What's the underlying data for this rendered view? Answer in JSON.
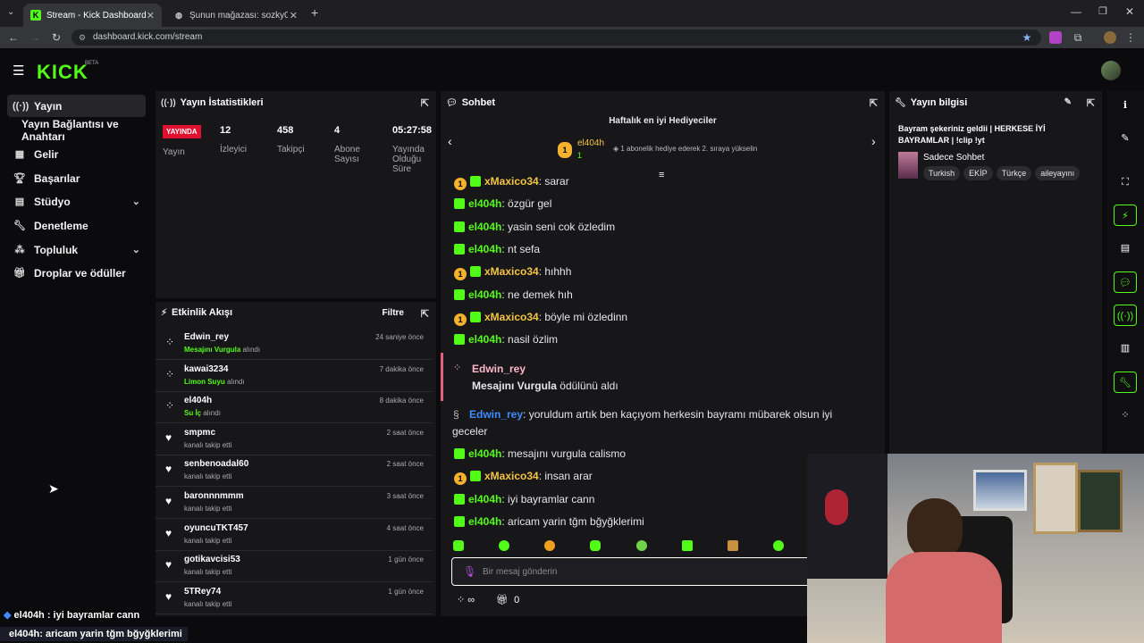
{
  "browser": {
    "tabs": [
      {
        "title": "Stream - Kick Dashboard",
        "active": true
      },
      {
        "title": "Şunun mağazası: sozky0 | Yayın",
        "active": false
      }
    ],
    "url": "dashboard.kick.com/stream"
  },
  "sidebar": {
    "items": [
      {
        "label": "Yayın",
        "icon": "broadcast-icon",
        "active": true
      },
      {
        "label": "Yayın Bağlantısı ve Anahtarı",
        "icon": "",
        "active": false
      },
      {
        "label": "Gelir",
        "icon": "revenue-icon",
        "active": false
      },
      {
        "label": "Başarılar",
        "icon": "trophy-icon",
        "active": false
      },
      {
        "label": "Stüdyo",
        "icon": "studio-icon",
        "active": false,
        "expandable": true
      },
      {
        "label": "Denetleme",
        "icon": "wrench-icon",
        "active": false
      },
      {
        "label": "Topluluk",
        "icon": "community-icon",
        "active": false,
        "expandable": true
      },
      {
        "label": "Droplar ve ödüller",
        "icon": "gift-icon",
        "active": false
      }
    ]
  },
  "stats": {
    "title": "Yayın İstatistikleri",
    "live_badge": "YAYINDA",
    "live_label": "Yayın",
    "viewers": {
      "value": "12",
      "label": "İzleyici"
    },
    "followers": {
      "value": "458",
      "label": "Takipçi"
    },
    "subs": {
      "value": "4",
      "label": "Abone Sayısı"
    },
    "uptime": {
      "value": "05:27:58",
      "label": "Yayında Olduğu Süre"
    }
  },
  "events": {
    "title": "Etkinlik Akışı",
    "filter": "Filtre",
    "rows": [
      {
        "name": "Edwin_rey",
        "reward": "Mesajını Vurgula",
        "suffix": "alındı",
        "time": "24 saniye önce",
        "icon": "reward-icon"
      },
      {
        "name": "kawai3234",
        "reward": "Limon Suyu",
        "suffix": "alındı",
        "time": "7 dakika önce",
        "icon": "reward-icon"
      },
      {
        "name": "el404h",
        "reward": "Su İç",
        "suffix": "alındı",
        "time": "8 dakika önce",
        "icon": "reward-icon"
      },
      {
        "name": "smpmc",
        "reward": "",
        "suffix": "kanalı takip etti",
        "time": "2 saat önce",
        "icon": "heart-icon"
      },
      {
        "name": "senbenoadal60",
        "reward": "",
        "suffix": "kanalı takip etti",
        "time": "2 saat önce",
        "icon": "heart-icon"
      },
      {
        "name": "baronnnmmm",
        "reward": "",
        "suffix": "kanalı takip etti",
        "time": "3 saat önce",
        "icon": "heart-icon"
      },
      {
        "name": "oyuncuTKT457",
        "reward": "",
        "suffix": "kanalı takip etti",
        "time": "4 saat önce",
        "icon": "heart-icon"
      },
      {
        "name": "gotikavcisi53",
        "reward": "",
        "suffix": "kanalı takip etti",
        "time": "1 gün önce",
        "icon": "heart-icon"
      },
      {
        "name": "5TRey74",
        "reward": "",
        "suffix": "kanalı takip etti",
        "time": "1 gün önce",
        "icon": "heart-icon"
      }
    ]
  },
  "chat": {
    "title": "Sohbet",
    "gifters_title": "Haftalık en iyi Hediyeciler",
    "top_gifter": {
      "name": "el404h",
      "count": "1",
      "note": "1 abonelik hediye ederek 2. sıraya yükselin"
    },
    "messages": [
      {
        "user": "xMaxico34",
        "color": "yellow",
        "text": "sarar",
        "badge1": true
      },
      {
        "user": "el404h",
        "color": "green",
        "text": "özgür gel",
        "badge1": false
      },
      {
        "user": "el404h",
        "color": "green",
        "text": "yasin seni cok özledim",
        "badge1": false
      },
      {
        "user": "el404h",
        "color": "green",
        "text": "nt sefa",
        "badge1": false
      },
      {
        "user": "xMaxico34",
        "color": "yellow",
        "text": "hıhhh",
        "badge1": true
      },
      {
        "user": "el404h",
        "color": "green",
        "text": "ne demek hıh",
        "badge1": false
      },
      {
        "user": "xMaxico34",
        "color": "yellow",
        "text": "böyle mi özledinn",
        "badge1": true
      },
      {
        "user": "el404h",
        "color": "green",
        "text": "nasil özlim",
        "badge1": false
      }
    ],
    "reward_event": {
      "user": "Edwin_rey",
      "reward": "Mesajını Vurgula",
      "suffix": "ödülünü aldı"
    },
    "highlight": {
      "user": "Edwin_rey",
      "text": "yoruldum artık ben kaçıyom herkesin bayramı mübarek olsun iyi",
      "text2": "geceler"
    },
    "messages2": [
      {
        "user": "el404h",
        "color": "green",
        "text": "mesajını vurgula calismo",
        "badge1": false
      },
      {
        "user": "xMaxico34",
        "color": "yellow",
        "text": "insan arar",
        "badge1": true
      },
      {
        "user": "el404h",
        "color": "green",
        "text": "iyi bayramlar cann",
        "badge1": false
      },
      {
        "user": "el404h",
        "color": "green",
        "text": "aricam yarin tğm bğyğklerimi",
        "badge1": false
      }
    ],
    "input_placeholder": "Bir mesaj gönderin",
    "footer_count": "0",
    "infinity": "∞"
  },
  "info": {
    "title": "Yayın bilgisi",
    "stream_title": "Bayram şekeriniz geldii | HERKESE İYİ BAYRAMLAR | !clip !yt",
    "category": "Sadece Sohbet",
    "tags": [
      "Turkish",
      "EKİP",
      "Türkçe",
      "aileyayını"
    ]
  },
  "overlay": {
    "line1": "el404h : iyi bayramlar cann",
    "line2": "el404h: aricam yarin tğm bğyğklerimi"
  }
}
